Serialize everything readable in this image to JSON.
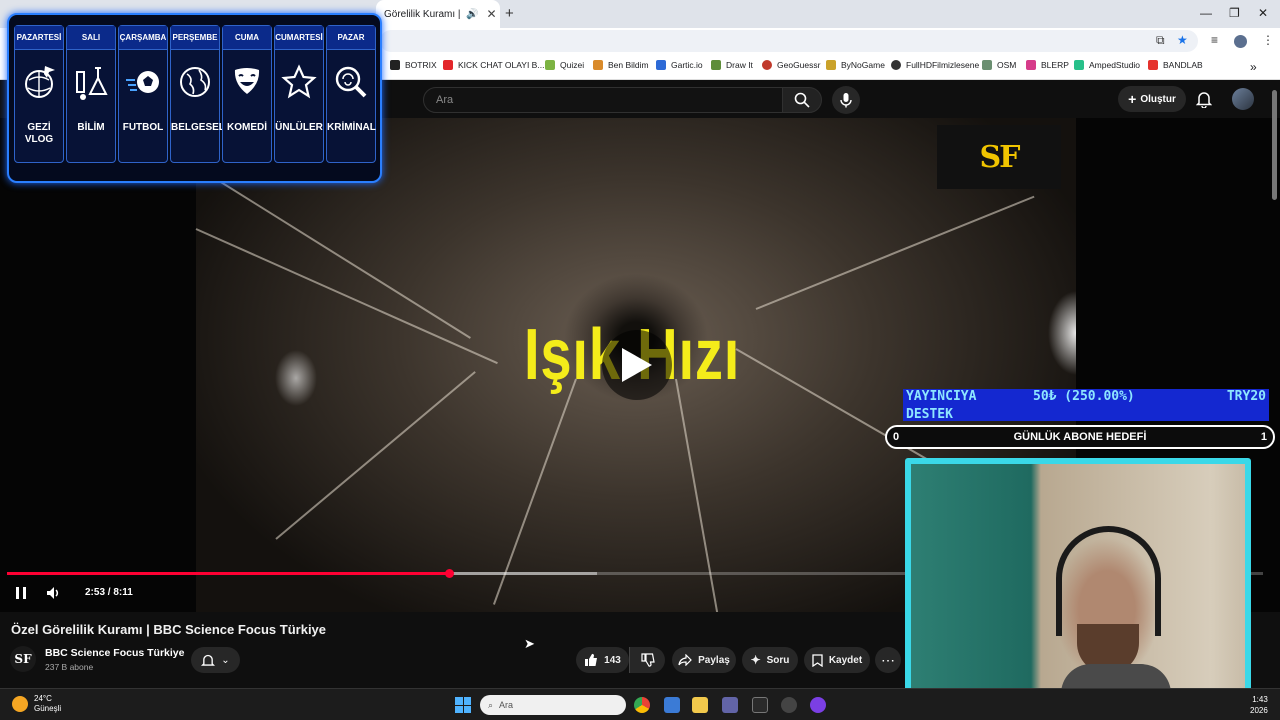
{
  "browser": {
    "tab_title": "Görelilik Kuramı | BBC",
    "bookmarks": [
      "BOTRIX",
      "KICK CHAT OLAYI B...",
      "Quizei",
      "Ben Bildim",
      "Gartic.io",
      "Draw It",
      "GeoGuessr",
      "ByNoGame",
      "FullHDFilmizlesene",
      "OSM",
      "BLERP",
      "AmpedStudio",
      "BANDLAB"
    ]
  },
  "youtube": {
    "search_placeholder": "Ara",
    "create_label": "Oluştur"
  },
  "video": {
    "overlay_text": "Işık Hızı",
    "logo_text": "SF",
    "time_display": "2:53 / 8:11",
    "progress_fraction": 0.352,
    "buffered_fraction": 0.47,
    "title": "Özel Görelilik Kuramı | BBC Science Focus Türkiye",
    "channel_name": "BBC Science Focus Türkiye",
    "channel_avatar": "SF",
    "subscribers": "237 B abone",
    "likes": "143",
    "share_label": "Paylaş",
    "ask_label": "Soru",
    "save_label": "Kaydet"
  },
  "schedule": {
    "days": [
      {
        "day": "PAZARTESİ",
        "topic": "GEZİ VLOG",
        "icon": "plane-globe-icon"
      },
      {
        "day": "SALI",
        "topic": "BİLİM",
        "icon": "science-icon"
      },
      {
        "day": "ÇARŞAMBA",
        "topic": "FUTBOL",
        "icon": "football-icon"
      },
      {
        "day": "PERŞEMBE",
        "topic": "BELGESEL",
        "icon": "globe-icon"
      },
      {
        "day": "CUMA",
        "topic": "KOMEDİ",
        "icon": "masks-icon"
      },
      {
        "day": "CUMARTESİ",
        "topic": "ÜNLÜLER",
        "icon": "star-icon"
      },
      {
        "day": "PAZAR",
        "topic": "KRİMİNAL",
        "icon": "fingerprint-icon"
      }
    ]
  },
  "donation": {
    "label_line1": "YAYINCIYA",
    "label_line2": "DESTEK",
    "amount": "50₺ (250.00%)",
    "currency": "TRY20"
  },
  "sub_goal": {
    "left": "0",
    "title": "GÜNLÜK ABONE HEDEFİ",
    "right": "1"
  },
  "taskbar": {
    "weather_temp": "24°C",
    "weather_desc": "Güneşli",
    "search_label": "Ara",
    "clock_time": "1:43",
    "clock_date": "2026"
  },
  "colors": {
    "accent_red": "#ff0033",
    "overlay_yellow": "#f4ec1a",
    "schedule_blue": "#2a7fff",
    "webcam_border": "#3ad8e8"
  }
}
